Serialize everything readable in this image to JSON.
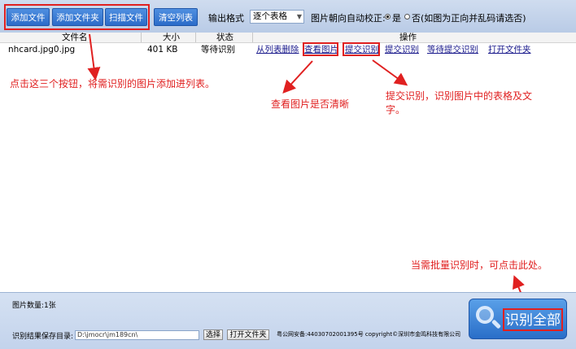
{
  "toolbar": {
    "add_file": "添加文件",
    "add_folder": "添加文件夹",
    "scan_file": "扫描文件",
    "clear_list": "清空列表",
    "output_format_label": "输出格式",
    "output_format_value": "逐个表格",
    "auto_rotate_label": "图片朝向自动校正:",
    "option_yes": "是",
    "option_no": "否(如图为正向并乱码请选否)",
    "selected_option": "是"
  },
  "table": {
    "headers": {
      "filename": "文件名",
      "size": "大小",
      "status": "状态",
      "action": "操作"
    },
    "rows": [
      {
        "filename": "nhcard.jpg0.jpg",
        "size": "401 KB",
        "status": "等待识别",
        "actions": {
          "remove": "从列表删除",
          "view": "查看图片",
          "submit": "提交识别",
          "submit2": "提交识别",
          "wait_submit": "等待提交识别",
          "open_folder": "打开文件夹"
        }
      }
    ]
  },
  "annotations": {
    "add_buttons": "点击这三个按钮，将需识别的图片添加进列表。",
    "view_image": "查看图片是否清晰",
    "submit_line1": "提交识别，识别图片中的表格及文",
    "submit_line2": "字。",
    "batch": "当需批量识别时，可点击此处。"
  },
  "annotation_color": "#e02020",
  "bottom": {
    "image_count": "图片数量:1张",
    "save_dir_label": "识别结果保存目录:",
    "save_dir_value": "D:\\jmocr\\jm189cn\\",
    "select_button": "选择",
    "open_folder_button": "打开文件夹",
    "footer_text": "粤公网安备:44030702001395号 copyright©深圳市金鸣科技有限公司",
    "recognize_all": "识别全部"
  }
}
